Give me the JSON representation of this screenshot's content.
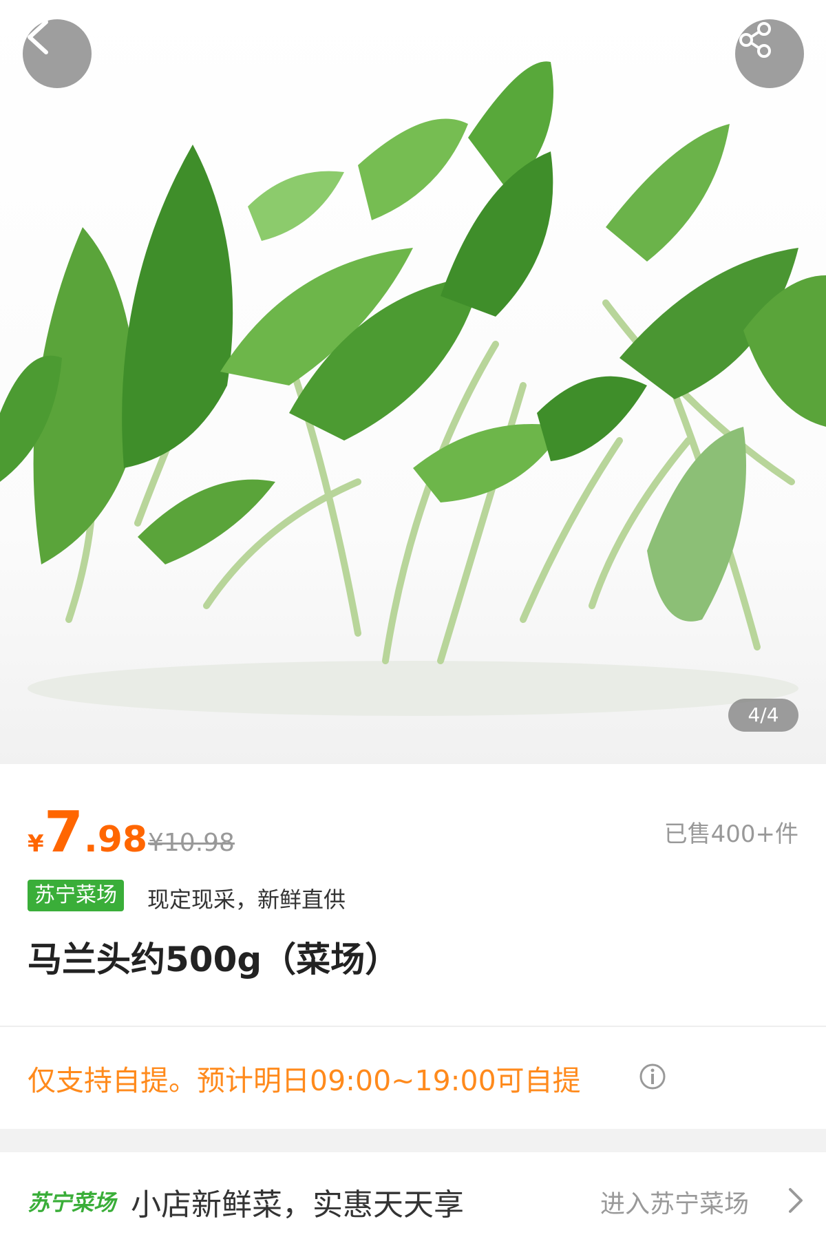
{
  "header": {
    "back_icon": "chevron-left-icon",
    "share_icon": "share-icon",
    "pager": "4/4"
  },
  "product": {
    "currency": "¥",
    "price_int": "7",
    "price_dec": ".98",
    "original_price": "¥10.98",
    "sold": "已售400+件",
    "store_badge": "苏宁菜场",
    "tag_text": "现定现采，新鲜直供",
    "title": "马兰头约500g（菜场）"
  },
  "pickup": {
    "text": "仅支持自提。预计明日09:00~19:00可自提",
    "info_icon": "info-icon"
  },
  "store": {
    "logo": "苏宁菜场",
    "slogan": "小店新鲜菜，实惠天天享",
    "link": "进入苏宁菜场",
    "chevron_icon": "chevron-right-icon"
  },
  "colors": {
    "price": "#ff6600",
    "pickup": "#ff8a1c",
    "brand_green": "#3aae39"
  }
}
